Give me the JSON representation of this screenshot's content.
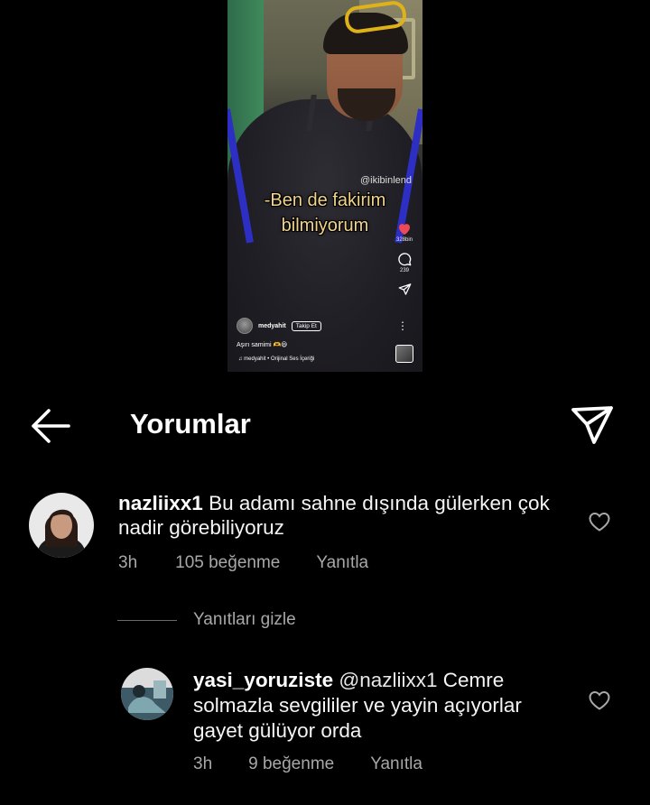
{
  "reel": {
    "watermark": "@ikibinlend",
    "caption_line1": "-Ben de fakirim",
    "caption_line2": "bilmiyorum",
    "likes_count": "328bin",
    "comments_count": "239",
    "author": "medyahit",
    "follow_label": "Takip Et",
    "description": "Aşırı samimi 🫶😃",
    "audio": "medyahit • Orijinal Ses İçeriği"
  },
  "header": {
    "title": "Yorumlar",
    "back_icon": "arrow-left-icon",
    "share_icon": "paper-plane-icon"
  },
  "comments": [
    {
      "username": "nazliixx1",
      "text": "Bu adamı sahne dışında gülerken çok nadir görebiliyoruz",
      "time": "3h",
      "likes": "105 beğenme",
      "reply_label": "Yanıtla"
    }
  ],
  "replies_toggle": {
    "label": "Yanıtları gizle"
  },
  "replies": [
    {
      "username": "yasi_yoruziste",
      "mention": "@nazliixx1",
      "text": "Cemre solmazla sevgililer ve yayin açıyorlar gayet gülüyor orda",
      "time": "3h",
      "likes": "9 beğenme",
      "reply_label": "Yanıtla"
    }
  ],
  "colors": {
    "background": "#000000",
    "text": "#ffffff",
    "muted": "#a8a8a8",
    "like_red": "#ed4956"
  }
}
